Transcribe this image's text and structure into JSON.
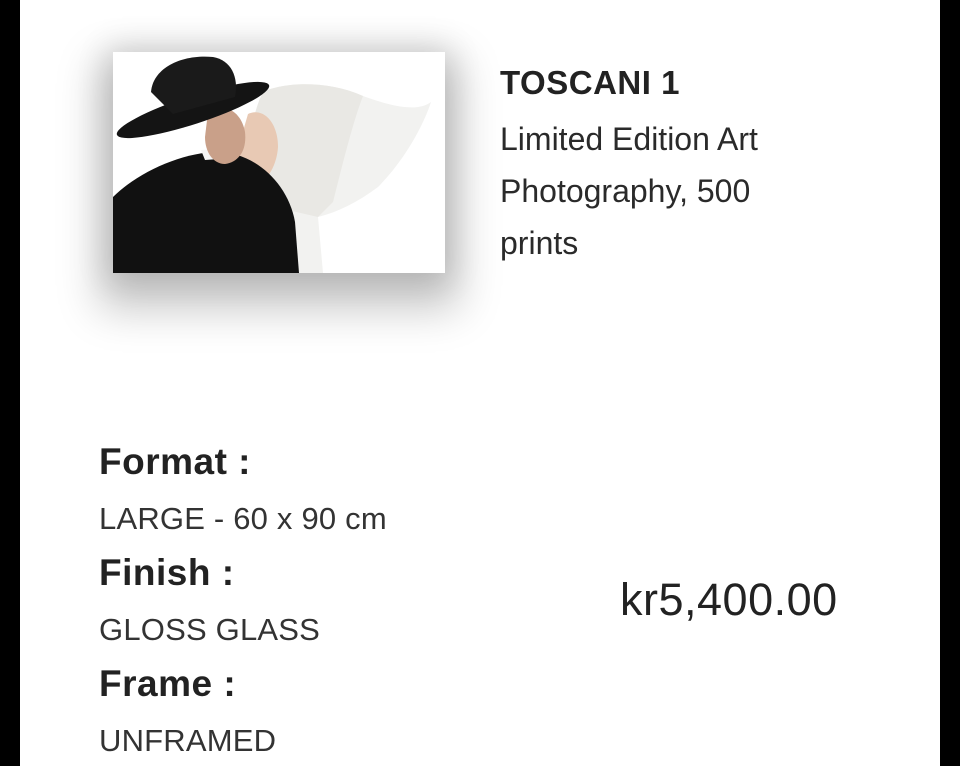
{
  "product": {
    "title": "TOSCANI 1",
    "description": "Limited Edition Art Photography, 500 prints",
    "image_icon": "photo-thumbnail"
  },
  "options": [
    {
      "label": "Format :",
      "value": "LARGE - 60 x 90 cm"
    },
    {
      "label": "Finish :",
      "value": "GLOSS GLASS"
    },
    {
      "label": "Frame :",
      "value": "UNFRAMED"
    }
  ],
  "price": "kr5,400.00",
  "colors": {
    "background_frame": "#000000",
    "card": "#ffffff",
    "text": "#222222"
  }
}
